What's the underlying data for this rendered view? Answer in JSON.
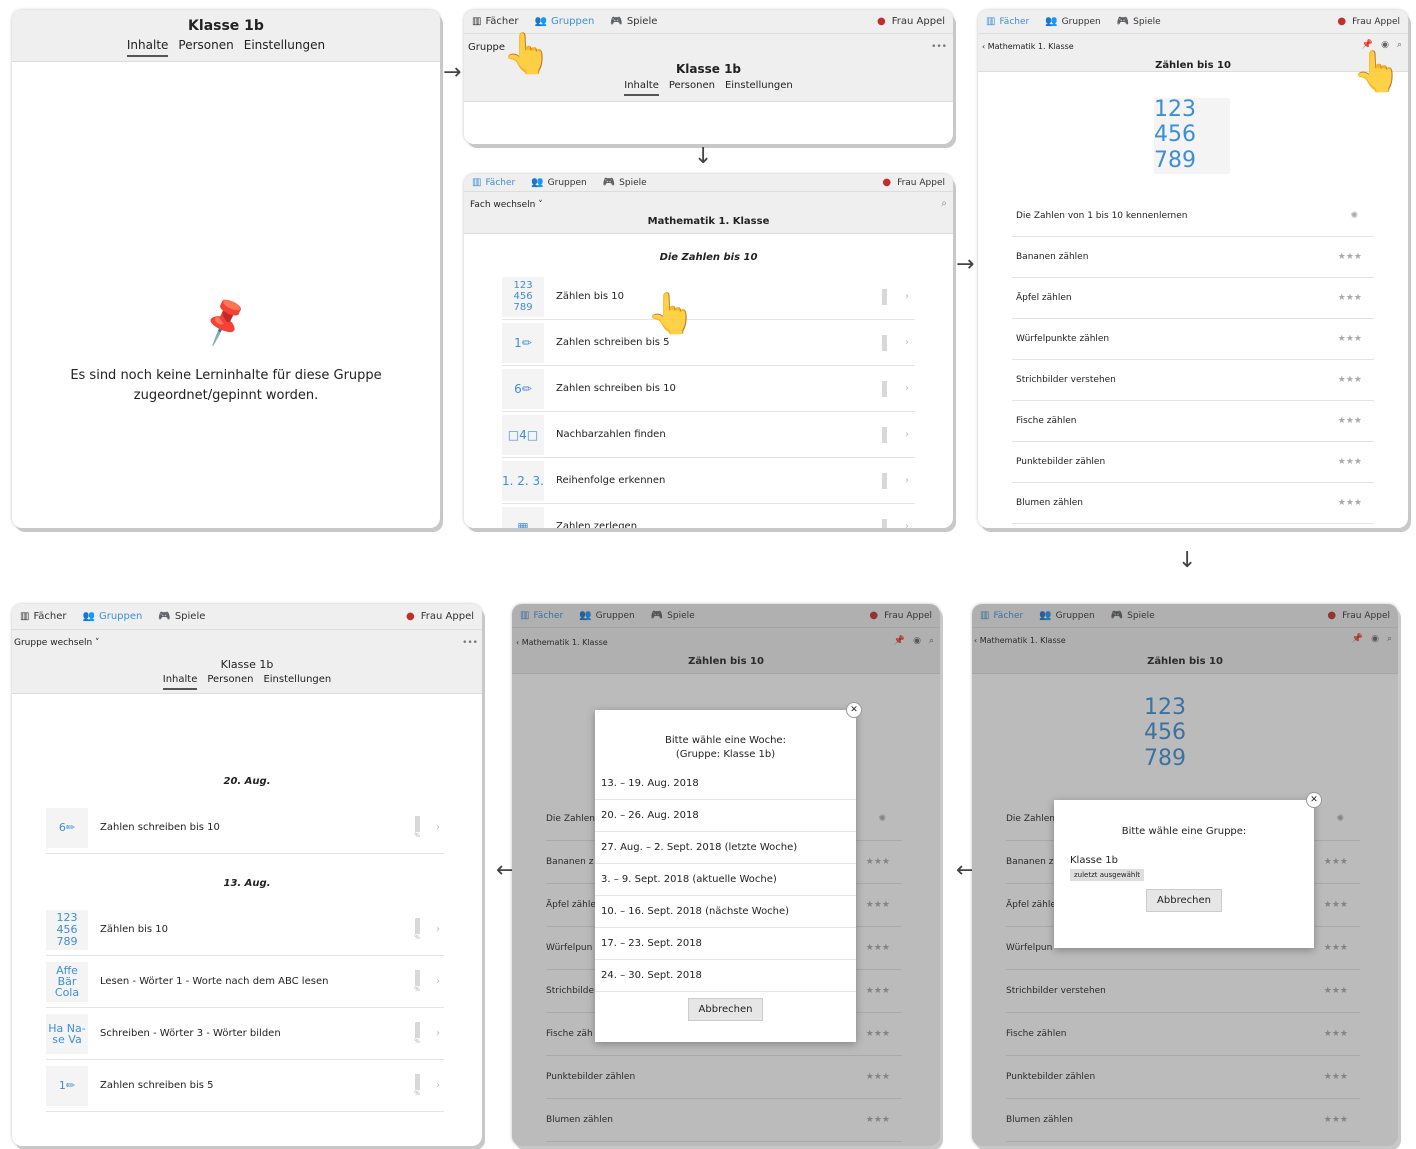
{
  "common": {
    "faecher": "Fächer",
    "gruppen": "Gruppen",
    "spiele": "Spiele",
    "user": "Frau Appel",
    "klasse": "Klasse 1b",
    "inhalte": "Inhalte",
    "personen": "Personen",
    "einstellungen": "Einstellungen",
    "gruppe_wechseln": "Gruppe wechseln",
    "gruppe_short": "Gruppe",
    "fach_wechseln": "Fach wechseln",
    "mathe": "Mathematik 1. Klasse",
    "zahlen_bis_10": "Zählen bis 10",
    "stars": "★★★",
    "digits": [
      "1",
      "2",
      "3",
      "4",
      "5",
      "6",
      "7",
      "8",
      "9"
    ],
    "abbrechen": "Abbrechen",
    "more": "•••"
  },
  "p1": {
    "empty": "Es sind noch keine Lerninhalte für diese Gruppe zugeordnet/gepinnt worden."
  },
  "p3": {
    "section": "Die Zahlen bis 10",
    "items": [
      {
        "icon": "123",
        "label": "Zählen bis 10"
      },
      {
        "icon": "1✏",
        "label": "Zahlen schreiben bis 5"
      },
      {
        "icon": "6✏",
        "label": "Zahlen schreiben bis 10"
      },
      {
        "icon": "□4□",
        "label": "Nachbarzahlen finden"
      },
      {
        "icon": "1. 2. 3.",
        "label": "Reihenfolge erkennen"
      },
      {
        "icon": "▦",
        "label": "Zahlen zerlegen"
      }
    ]
  },
  "p4": {
    "items": [
      "Die Zahlen von 1 bis 10 kennenlernen",
      "Bananen zählen",
      "Äpfel zählen",
      "Würfelpunkte zählen",
      "Strichbilder verstehen",
      "Fische zählen",
      "Punktebilder zählen",
      "Blumen zählen"
    ]
  },
  "p5": {
    "dates": [
      "20. Aug.",
      "13. Aug."
    ],
    "items_a": [
      {
        "label": "Zahlen schreiben bis 10",
        "icon": "6✏"
      }
    ],
    "items_b": [
      {
        "label": "Zählen bis 10",
        "icon": "123"
      },
      {
        "label": "Lesen - Wörter 1 - Worte nach dem ABC lesen",
        "icon": "Affe Bär Cola"
      },
      {
        "label": "Schreiben - Wörter 3 - Wörter bilden",
        "icon": "Ha Na-se Va"
      },
      {
        "label": "Zahlen schreiben bis 5",
        "icon": "1✏"
      }
    ],
    "pct": "%"
  },
  "p6": {
    "title1": "Bitte wähle eine Woche:",
    "title2": "(Gruppe: Klasse 1b)",
    "weeks": [
      "13. – 19. Aug. 2018",
      "20. – 26. Aug. 2018",
      "27. Aug. – 2. Sept. 2018 (letzte Woche)",
      "3. – 9. Sept. 2018 (aktuelle Woche)",
      "10. – 16. Sept. 2018 (nächste Woche)",
      "17. – 23. Sept. 2018",
      "24. – 30. Sept. 2018"
    ],
    "bg_items": [
      "Die Zahlen",
      "Bananen z",
      "Äpfel zähle",
      "Würfelpun",
      "Strichbilde",
      "Fische zäh",
      "Punktebilder zählen",
      "Blumen zählen"
    ]
  },
  "p7": {
    "title": "Bitte wähle eine Gruppe:",
    "group": "Klasse 1b",
    "badge": "zuletzt ausgewählt",
    "bg_items": [
      "Die Zahlen",
      "Bananen z",
      "Äpfel zähle",
      "Würfelpun",
      "Strichbilder verstehen",
      "Fische zählen",
      "Punktebilder zählen",
      "Blumen zählen"
    ]
  }
}
